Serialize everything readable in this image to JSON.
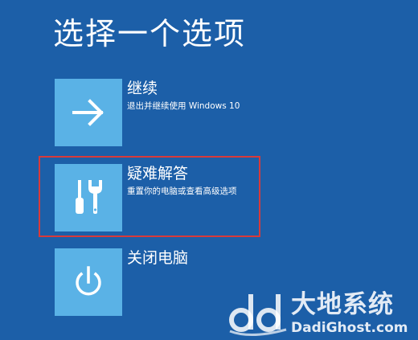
{
  "screen": {
    "title": "选择一个选项",
    "background_color": "#1c5fa8",
    "tile_color": "#5ab2e6",
    "highlight_color": "#d83a3a"
  },
  "options": [
    {
      "label": "继续",
      "description": "退出并继续使用 Windows 10",
      "icon": "arrow-right-icon"
    },
    {
      "label": "疑难解答",
      "description": "重置你的电脑或查看高级选项",
      "icon": "tools-icon",
      "highlighted": true
    },
    {
      "label": "关闭电脑",
      "description": "",
      "icon": "power-icon"
    }
  ],
  "watermark": {
    "name": "大地系统",
    "url": "DadiGhost.com"
  }
}
